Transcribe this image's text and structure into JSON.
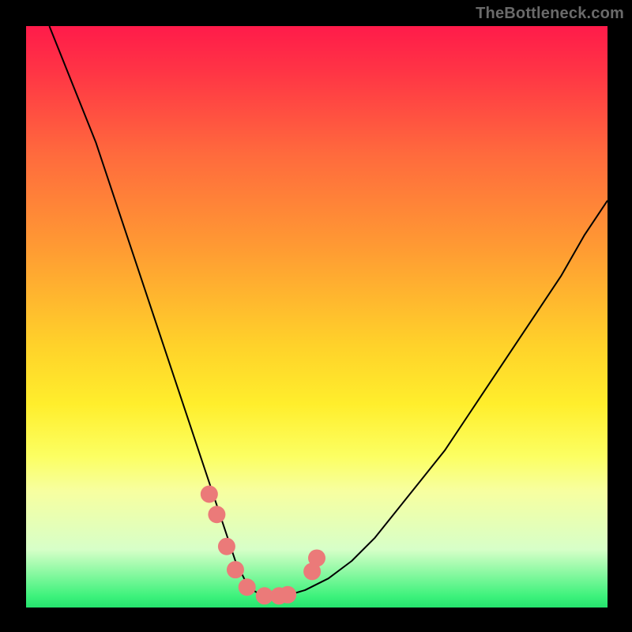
{
  "watermark": {
    "text": "TheBottleneck.com"
  },
  "chart_data": {
    "type": "line",
    "title": "",
    "xlabel": "",
    "ylabel": "",
    "xlim": [
      0,
      100
    ],
    "ylim": [
      0,
      100
    ],
    "grid": false,
    "legend": false,
    "series": [
      {
        "name": "bottleneck-curve",
        "stroke": "#000000",
        "stroke_width": 2,
        "x": [
          4,
          6,
          8,
          10,
          12,
          14,
          16,
          18,
          20,
          22,
          24,
          26,
          28,
          30,
          32,
          34,
          35,
          36,
          37,
          38,
          39,
          40,
          41,
          42,
          44,
          46,
          48,
          52,
          56,
          60,
          64,
          68,
          72,
          76,
          80,
          84,
          88,
          92,
          96,
          100
        ],
        "y": [
          100,
          95,
          90,
          85,
          80,
          74,
          68,
          62,
          56,
          50,
          44,
          38,
          32,
          26,
          20,
          14,
          11,
          8,
          6,
          4,
          3,
          2.4,
          2,
          2,
          2,
          2.4,
          3,
          5,
          8,
          12,
          17,
          22,
          27,
          33,
          39,
          45,
          51,
          57,
          64,
          70
        ]
      },
      {
        "name": "highlight-dots",
        "type": "scatter",
        "color": "#eb7a79",
        "radius_px": 11,
        "x": [
          31.5,
          32.8,
          34.5,
          36.0,
          38.0,
          41.0,
          43.5,
          45.0,
          49.2,
          50.0
        ],
        "y": [
          19.5,
          16.0,
          10.5,
          6.5,
          3.5,
          2.0,
          2.0,
          2.2,
          6.2,
          8.5
        ]
      }
    ]
  }
}
